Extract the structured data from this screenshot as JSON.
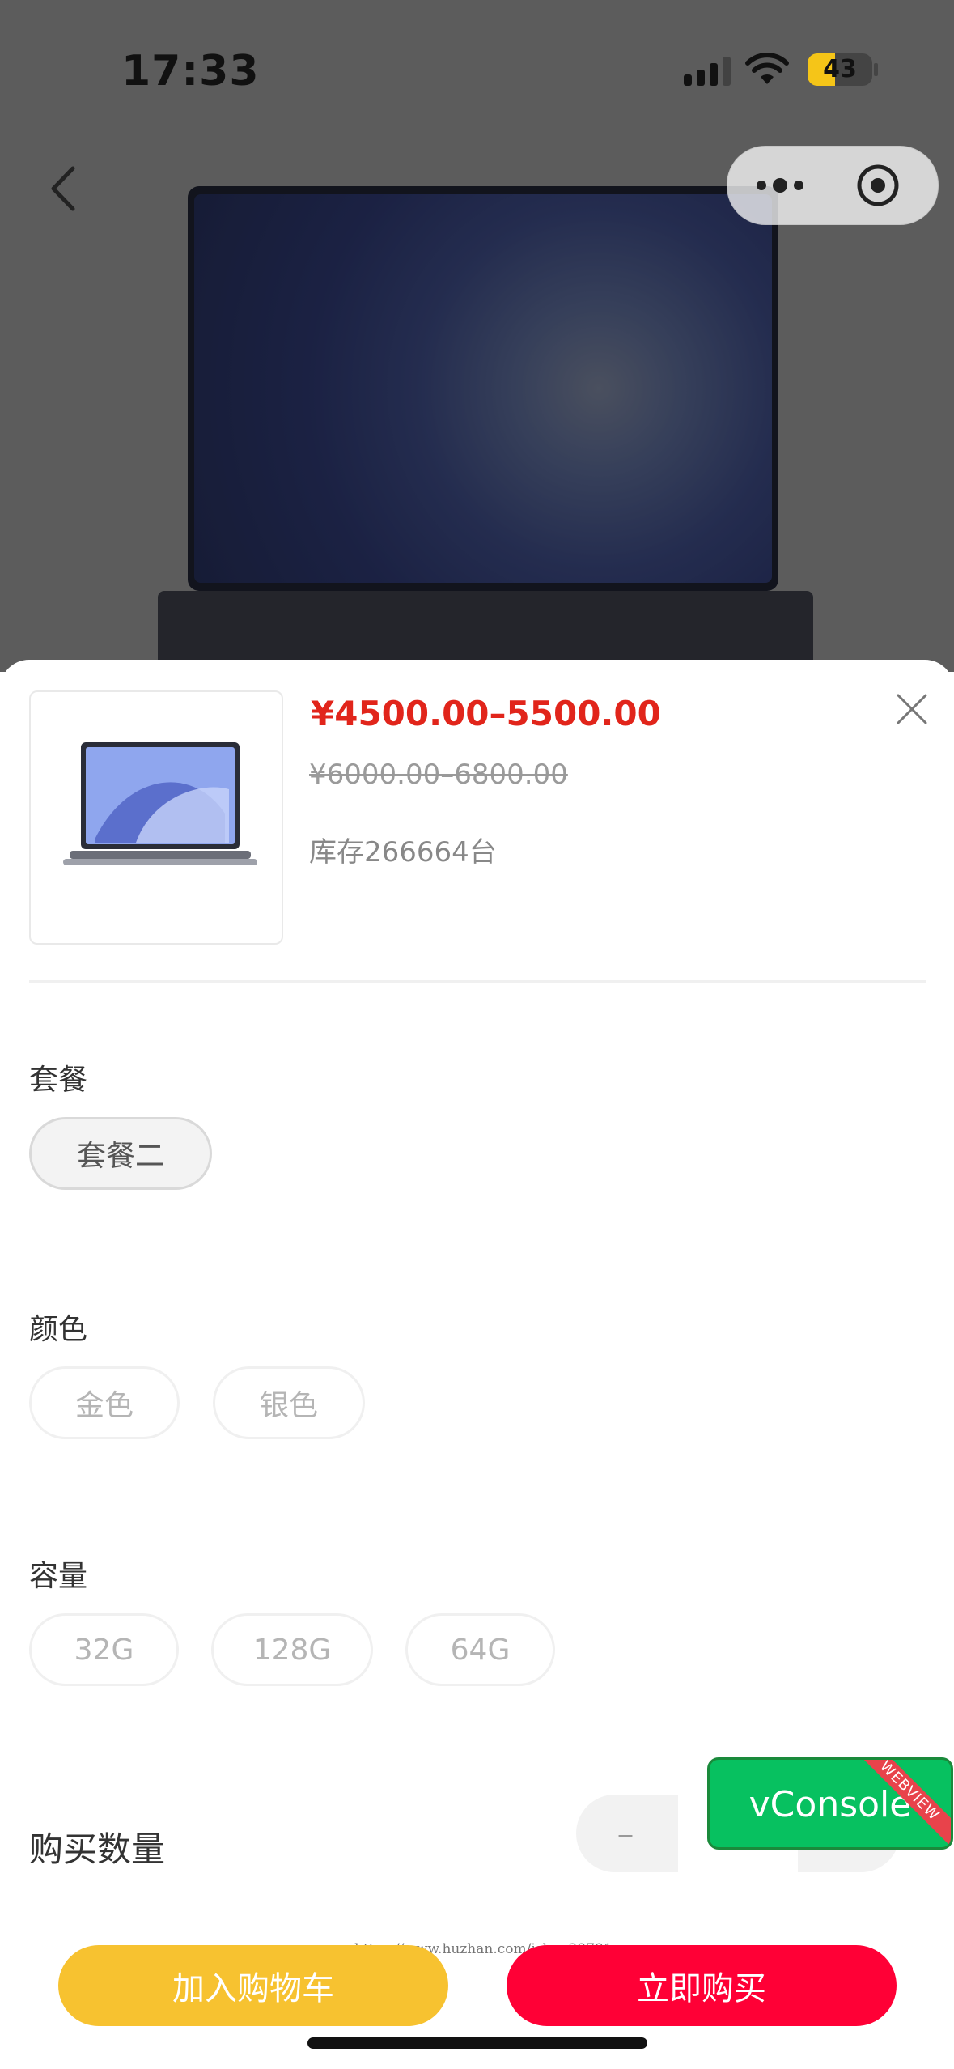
{
  "status_bar": {
    "time": "17:33",
    "battery": "43"
  },
  "product": {
    "price": "¥4500.00–5500.00",
    "original_price": "¥6000.00–6800.00",
    "stock": "库存266664台"
  },
  "sections": {
    "package": {
      "title": "套餐",
      "options": [
        "套餐二"
      ],
      "selected": "套餐二"
    },
    "color": {
      "title": "颜色",
      "options": [
        "金色",
        "银色"
      ]
    },
    "capacity": {
      "title": "容量",
      "options": [
        "32G",
        "128G",
        "64G"
      ]
    }
  },
  "quantity": {
    "label": "购买数量",
    "minus": "–",
    "value": "",
    "plus": ""
  },
  "vconsole": {
    "label": "vConsole",
    "ribbon": "WEBVIEW"
  },
  "watermark": "https://www.huzhan.com/ishop29781",
  "buttons": {
    "add_to_cart": "加入购物车",
    "buy_now": "立即购买"
  },
  "colors": {
    "price": "#e1251b",
    "cart_button": "#f7c230",
    "buy_button": "#ff0036",
    "vconsole": "#07c160"
  }
}
